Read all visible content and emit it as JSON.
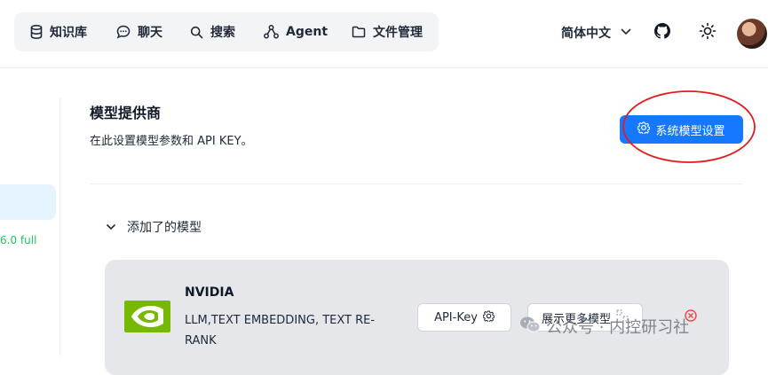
{
  "nav": {
    "items": [
      {
        "label": "知识库",
        "icon": "database-icon"
      },
      {
        "label": "聊天",
        "icon": "chat-bubble-icon"
      },
      {
        "label": "搜索",
        "icon": "search-icon"
      },
      {
        "label": "Agent",
        "icon": "agent-graph-icon"
      },
      {
        "label": "文件管理",
        "icon": "folder-icon"
      }
    ]
  },
  "header": {
    "language": "简体中文",
    "icons": [
      "github-icon",
      "sun-icon",
      "avatar"
    ]
  },
  "sidebar": {
    "version": "6.0 full"
  },
  "section": {
    "title": "模型提供商",
    "subtitle": "在此设置模型参数和 API KEY。",
    "system_settings_button": "系统模型设置"
  },
  "added_models": {
    "toggle_label": "添加了的模型",
    "providers": [
      {
        "name": "NVIDIA",
        "tags_line1": "LLM,TEXT EMBEDDING, TEXT RE-",
        "tags_line2": "RANK",
        "api_key_button": "API-Key",
        "show_more_button": "展示更多模型"
      }
    ]
  },
  "watermark": {
    "text": "公众号 · 内控研习社"
  },
  "colors": {
    "primary": "#1677ff",
    "annotation": "#e11d1d",
    "nvidia": "#76b900",
    "version_green": "#22c55e"
  }
}
